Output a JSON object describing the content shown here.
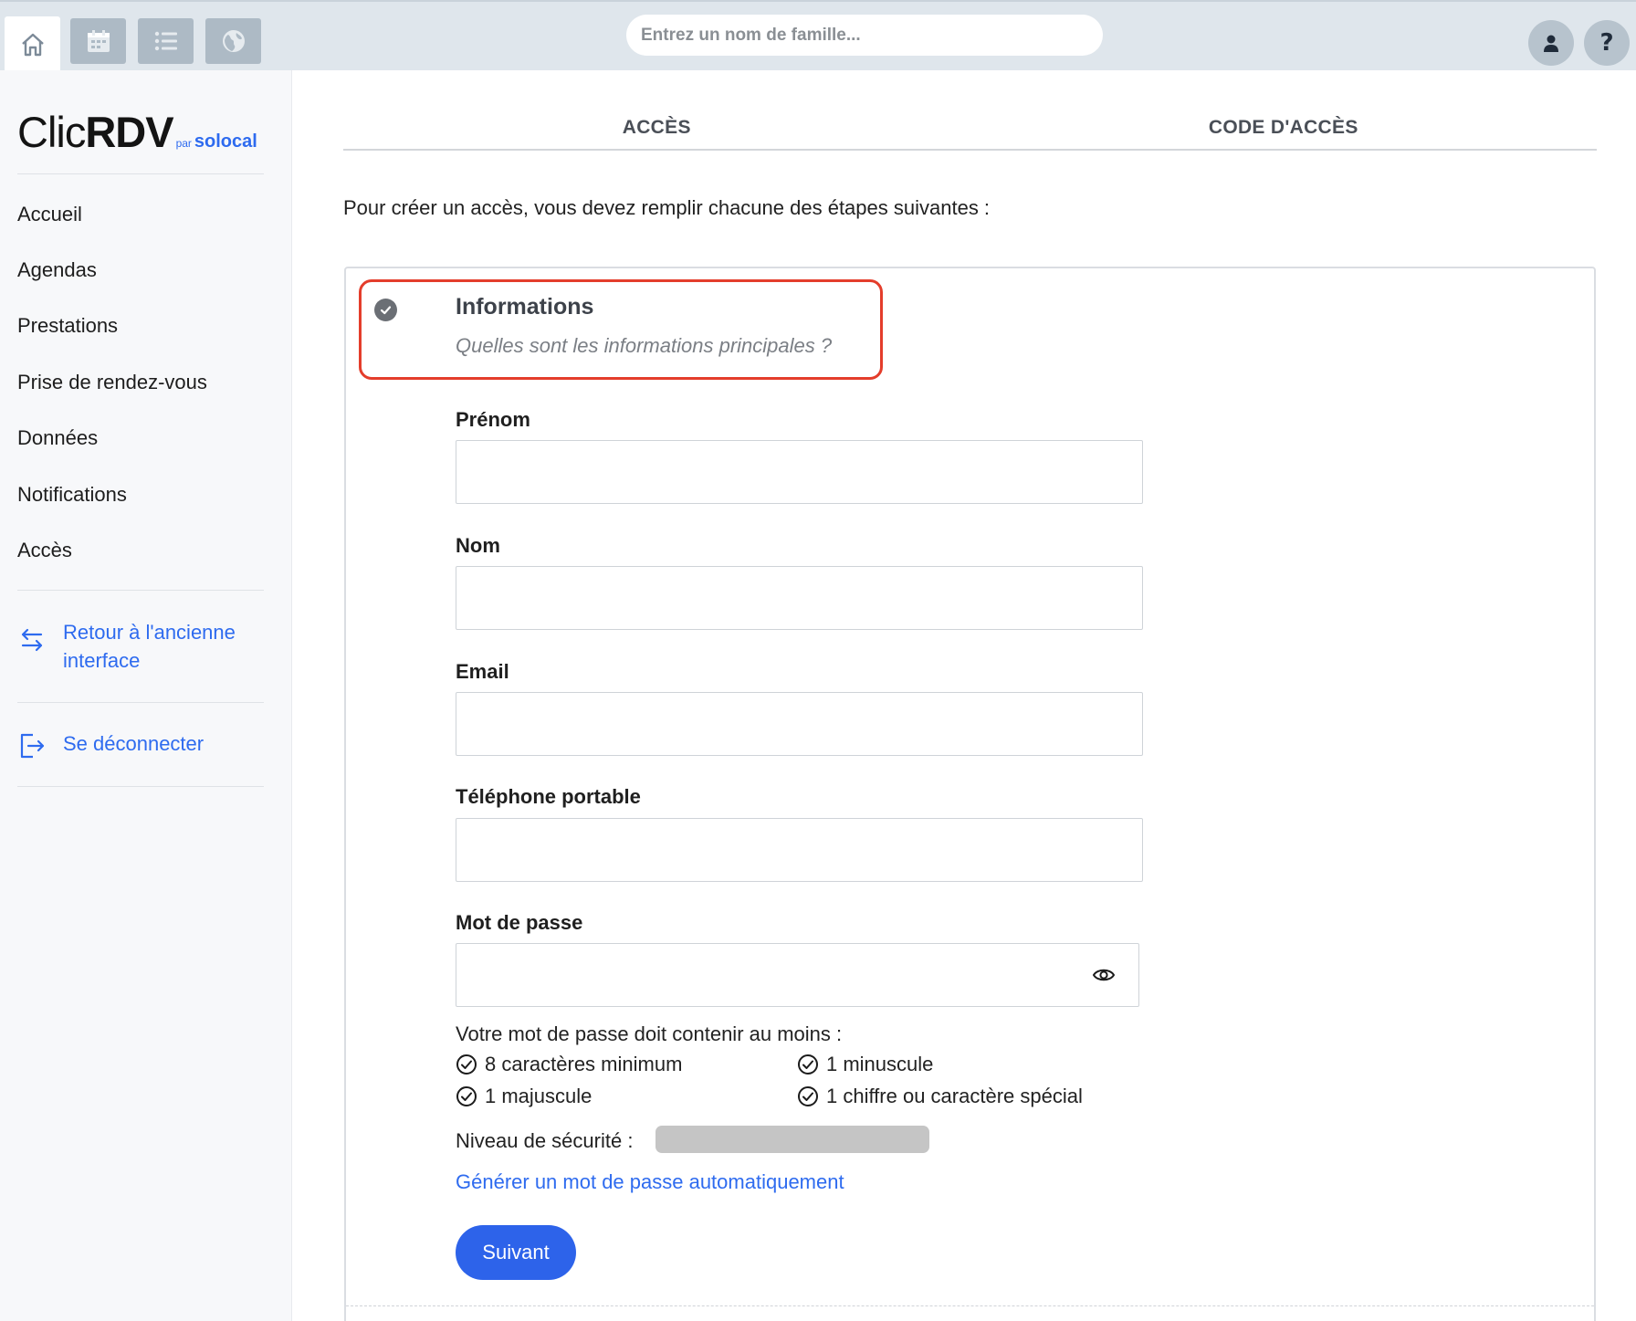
{
  "topbar": {
    "search_placeholder": "Entrez un nom de famille...",
    "icons": [
      "home-icon",
      "calendar-icon",
      "list-icon",
      "globe-icon",
      "user-icon",
      "help-icon"
    ],
    "help_glyph": "?"
  },
  "sidebar": {
    "logo": {
      "clic": "Clic",
      "rdv": "RDV",
      "par": "par",
      "solocal": "solocal"
    },
    "items": [
      {
        "label": "Accueil"
      },
      {
        "label": "Agendas"
      },
      {
        "label": "Prestations"
      },
      {
        "label": "Prise de rendez-vous"
      },
      {
        "label": "Données"
      },
      {
        "label": "Notifications"
      },
      {
        "label": "Accès"
      }
    ],
    "back_link": {
      "line1": "Retour à l'ancienne",
      "line2": "interface"
    },
    "logout_label": "Se déconnecter"
  },
  "main": {
    "tabs": [
      {
        "label": "ACCÈS"
      },
      {
        "label": "CODE D'ACCÈS"
      }
    ],
    "intro": "Pour créer un accès, vous devez remplir chacune des étapes suivantes :",
    "step": {
      "title": "Informations",
      "subtitle": "Quelles sont les informations principales ?"
    },
    "fields": {
      "firstname_label": "Prénom",
      "firstname_value": "",
      "lastname_label": "Nom",
      "lastname_value": "",
      "email_label": "Email",
      "email_value": "",
      "phone_label": "Téléphone portable",
      "phone_value": "",
      "password_label": "Mot de passe",
      "password_value": ""
    },
    "password_rules": {
      "title": "Votre mot de passe doit contenir au moins :",
      "min_chars": "8 caractères minimum",
      "lowercase": "1 minuscule",
      "uppercase": "1 majuscule",
      "digit_special": "1 chiffre ou caractère spécial"
    },
    "security_label": "Niveau de sécurité :",
    "security_level": 0,
    "generate_link": "Générer un mot de passe automatiquement",
    "next_button": "Suivant"
  },
  "colors": {
    "accent": "#2d63ea",
    "link": "#2e6bef",
    "highlight": "#e43d2b",
    "topbar": "#dfe6ec"
  }
}
